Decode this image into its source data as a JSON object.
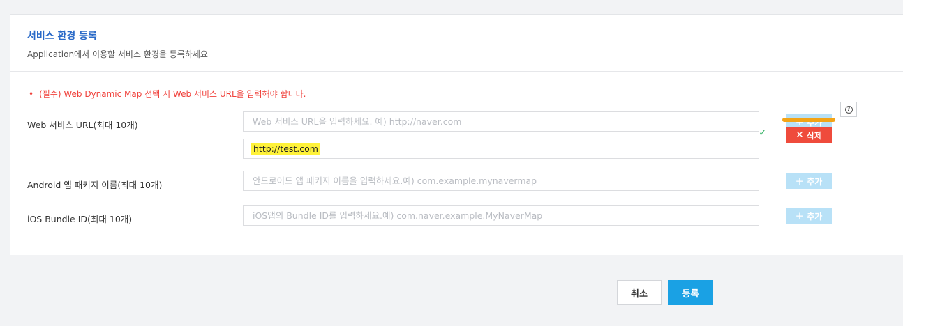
{
  "header": {
    "title": "서비스 환경 등록",
    "subtitle": "Application에서 이용할 서비스 환경을 등록하세요"
  },
  "notice": {
    "bullet": "•",
    "text": "(필수) Web Dynamic Map 선택 시 Web 서비스 URL을 입력해야 합니다."
  },
  "rows": {
    "web": {
      "label": "Web 서비스 URL(최대 10개)",
      "placeholder": "Web 서비스 URL을 입력하세요. 예) http://naver.com",
      "entered_value": "http://test.com"
    },
    "android": {
      "label": "Android 앱 패키지 이름(최대 10개)",
      "placeholder": "안드로이드 앱 패키지 이름을 입력하세요.예) com.example.mynavermap"
    },
    "ios": {
      "label": "iOS Bundle ID(최대 10개)",
      "placeholder": "iOS앱의 Bundle ID를 입력하세요.예) com.naver.example.MyNaverMap"
    }
  },
  "buttons": {
    "add_symbol": "+",
    "add_label": "추가",
    "delete_symbol": "✕",
    "delete_label": "삭제",
    "help_symbol": "?",
    "check_symbol": "✓",
    "cancel_label": "취소",
    "submit_label": "등록"
  },
  "colors": {
    "title_blue": "#2a6ac8",
    "notice_red": "#f0413b",
    "add_button_disabled": "#b8e1f7",
    "delete_red": "#ef4b3c",
    "submit_blue": "#1aa1e4",
    "highlight_yellow": "#fff23a",
    "annotation_orange": "#f3a417",
    "check_green": "#3db66b"
  }
}
